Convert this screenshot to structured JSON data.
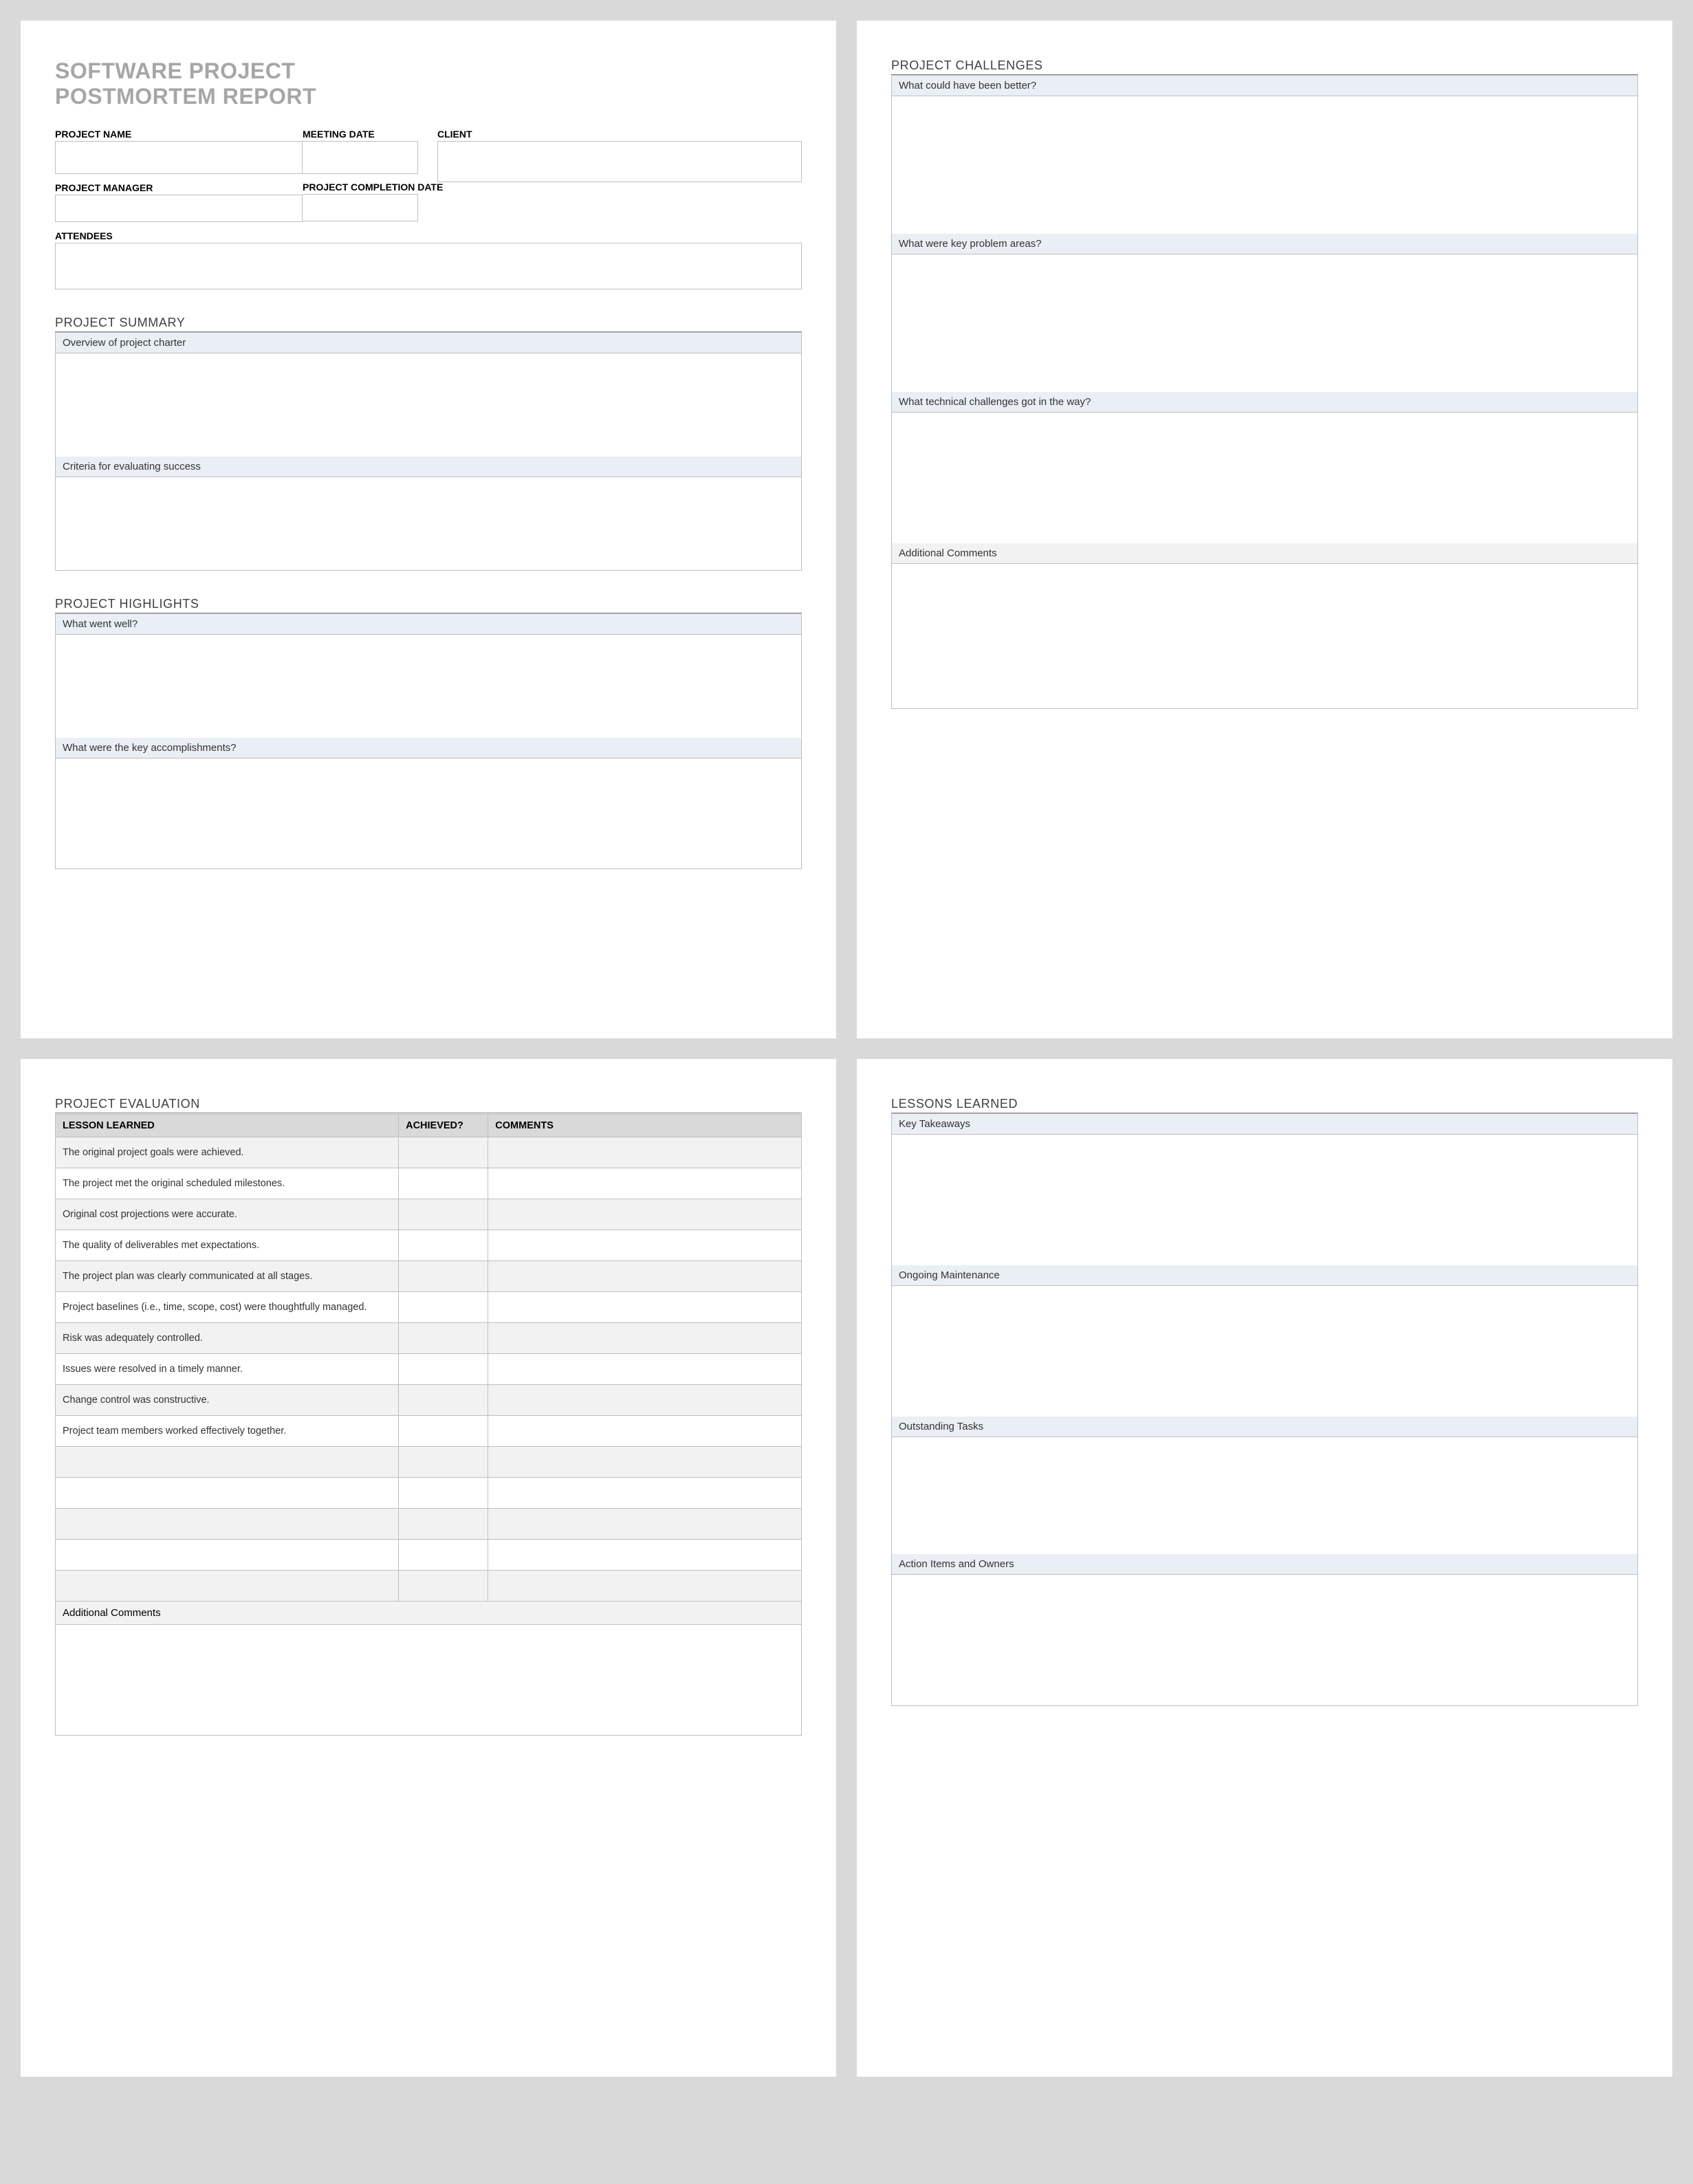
{
  "document": {
    "title_line1": "SOFTWARE PROJECT",
    "title_line2": "POSTMORTEM REPORT"
  },
  "header_fields": {
    "project_name_label": "PROJECT NAME",
    "meeting_date_label": "MEETING DATE",
    "client_label": "CLIENT",
    "project_manager_label": "PROJECT MANAGER",
    "project_completion_date_label": "PROJECT COMPLETION DATE",
    "attendees_label": "ATTENDEES"
  },
  "project_summary": {
    "heading": "PROJECT SUMMARY",
    "items": [
      "Overview of project charter",
      "Criteria for evaluating success"
    ]
  },
  "project_highlights": {
    "heading": "PROJECT HIGHLIGHTS",
    "items": [
      "What went well?",
      "What were the key accomplishments?"
    ]
  },
  "project_challenges": {
    "heading": "PROJECT CHALLENGES",
    "items": [
      "What could have been better?",
      "What were key problem areas?",
      "What technical challenges got in the way?",
      "Additional Comments"
    ]
  },
  "project_evaluation": {
    "heading": "PROJECT EVALUATION",
    "columns": [
      "LESSON LEARNED",
      "ACHIEVED?",
      "COMMENTS"
    ],
    "rows": [
      "The original project goals were achieved.",
      "The project met the original scheduled milestones.",
      "Original cost projections were accurate.",
      "The quality of deliverables met expectations.",
      "The project plan was clearly communicated at all stages.",
      "Project baselines (i.e., time, scope, cost) were thoughtfully managed.",
      "Risk was adequately controlled.",
      "Issues were resolved in a timely manner.",
      "Change control was constructive.",
      "Project team members worked effectively together.",
      "",
      "",
      "",
      "",
      ""
    ],
    "additional_comments_label": "Additional Comments"
  },
  "lessons_learned": {
    "heading": "LESSONS LEARNED",
    "items": [
      "Key Takeaways",
      "Ongoing Maintenance",
      "Outstanding Tasks",
      "Action Items and Owners"
    ]
  }
}
